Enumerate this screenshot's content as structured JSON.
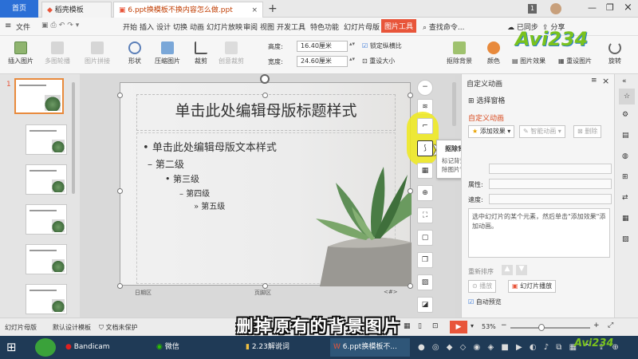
{
  "tabs": {
    "home": "首页",
    "template": "稻壳模板",
    "doc": "6.ppt换模板不换内容怎么做.ppt",
    "add": "+",
    "count": "1"
  },
  "menu": {
    "file": "文件",
    "items": [
      "开始",
      "插入",
      "设计",
      "切换",
      "动画",
      "幻灯片放映",
      "审阅",
      "视图",
      "开发工具",
      "特色功能",
      "幻灯片母版"
    ],
    "active": "图片工具",
    "search": "查找命令...",
    "sync": "已同步",
    "share": "分享"
  },
  "ribbon": {
    "insert_image": "插入图片",
    "multi_round": "多图轮播",
    "image_joint": "图片拼接",
    "shape": "形状",
    "compress": "压缩图片",
    "crop": "裁剪",
    "create_art": "创意裁剪",
    "height_label": "高度:",
    "height_value": "16.40厘米",
    "width_label": "宽度:",
    "width_value": "24.60厘米",
    "lock_ratio": "锁定纵横比",
    "reset_size": "重设大小",
    "remove_bg": "抠除背景",
    "color": "颜色",
    "image_effect": "图片效果",
    "reset_image": "重设图片",
    "rotate": "旋转"
  },
  "slide": {
    "title": "单击此处编辑母版标题样式",
    "level1": "单击此处编辑母版文本样式",
    "level2": "第二级",
    "level3": "第三级",
    "level4": "第四级",
    "level5": "第五级",
    "date": "日期区",
    "footer": "页脚区",
    "page": "<#>"
  },
  "thumb_number": "1",
  "tooltip": {
    "title": "抠除背景",
    "desc": "标记背景区域，快速智能抠除图片背景"
  },
  "panel": {
    "header": "自定义动画",
    "select_pane": "选择窗格",
    "section": "自定义动画",
    "add_effect": "添加效果",
    "smart_anim": "智能动画",
    "delete": "删除",
    "attr": "属性:",
    "speed": "速度:",
    "hint": "选中幻灯片的某个元素，然后单击\"添加效果\"添加动画。",
    "reorder": "重新排序",
    "play": "播放",
    "slideshow": "幻灯片播放",
    "autopreview": "自动预览"
  },
  "status": {
    "mode": "幻灯片母版",
    "template": "默认设计模板",
    "protect": "文档未保护",
    "zoom": "53%"
  },
  "subtitle": "删掉原有的背景图片",
  "taskbar": {
    "bandicam": "Bandicam",
    "wechat": "微信",
    "folder": "2.23解说词",
    "wps": "6.ppt换模板不..."
  },
  "colors": {
    "accent_blue": "#2b6fd6",
    "picture_tools": "#e8553a",
    "panel_title": "#d94a1e",
    "taskbar": "#1f3a56",
    "highlight": "#f0ea1a"
  }
}
